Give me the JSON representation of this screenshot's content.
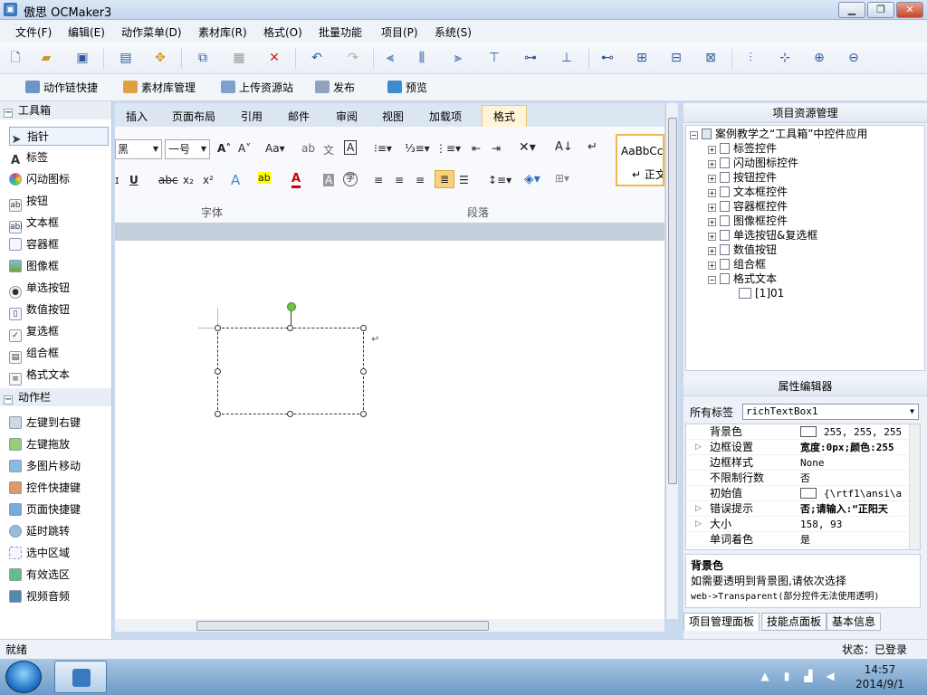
{
  "window": {
    "title": "傲思 OCMaker3"
  },
  "menu": [
    "文件(F)",
    "编辑(E)",
    "动作菜单(D)",
    "素材库(R)",
    "格式(O)",
    "批量功能",
    "项目(P)",
    "系统(S)"
  ],
  "toolbar2": {
    "action_chain": "动作链快捷",
    "library": "素材库管理",
    "upload": "上传资源站",
    "publish": "发布",
    "preview": "预览"
  },
  "toolbox": {
    "header": "工具箱",
    "items": [
      "指针",
      "标签",
      "闪动图标",
      "按钮",
      "文本框",
      "容器框",
      "图像框",
      "单选按钮",
      "数值按钮",
      "复选框",
      "组合框",
      "格式文本"
    ]
  },
  "actionbar": {
    "header": "动作栏",
    "items": [
      "左键到右键",
      "左键拖放",
      "多图片移动",
      "控件快捷键",
      "页面快捷键",
      "延时跳转",
      "选中区域",
      "有效选区",
      "视频音频"
    ]
  },
  "ribbon": {
    "tabs": [
      "插入",
      "页面布局",
      "引用",
      "邮件",
      "审阅",
      "视图",
      "加载项",
      "格式"
    ],
    "font_name": "黑",
    "font_size": "一号",
    "style_preview": "AaBbCcI",
    "style_name": "正文",
    "group_font": "字体",
    "group_paragraph": "段落"
  },
  "project_panel": {
    "title": "项目资源管理",
    "root": "案例教学之“工具箱”中控件应用",
    "nodes": [
      "标签控件",
      "闪动图标控件",
      "按钮控件",
      "文本框控件",
      "容器框控件",
      "图像框控件",
      "单选按钮&复选框",
      "数值按钮",
      "组合框",
      "格式文本"
    ],
    "leaf": "[1]01"
  },
  "property_panel": {
    "title": "属性编辑器",
    "all_tags_label": "所有标签",
    "selected_object": "richTextBox1",
    "rows": [
      {
        "name": "背景色",
        "value": "255, 255, 255"
      },
      {
        "name": "边框设置",
        "value": "宽度:0px;颜色:255"
      },
      {
        "name": "边框样式",
        "value": "None"
      },
      {
        "name": "不限制行数",
        "value": "否"
      },
      {
        "name": "初始值",
        "value": "{\\rtf1\\ansi\\a"
      },
      {
        "name": "错误提示",
        "value": "否;请输入:“正阳天"
      },
      {
        "name": "大小",
        "value": "158, 93"
      },
      {
        "name": "单词着色",
        "value": "是"
      }
    ],
    "desc_title": "背景色",
    "desc_text1": "如需要透明到背景图,请依次选择",
    "desc_text2": "web->Transparent(部分控件无法使用透明)"
  },
  "bottom_tabs": [
    "项目管理面板",
    "技能点面板",
    "基本信息"
  ],
  "status": {
    "left": "就绪",
    "right": "状态：已登录"
  },
  "taskbar": {
    "time": "14:57",
    "date": "2014/9/1"
  }
}
